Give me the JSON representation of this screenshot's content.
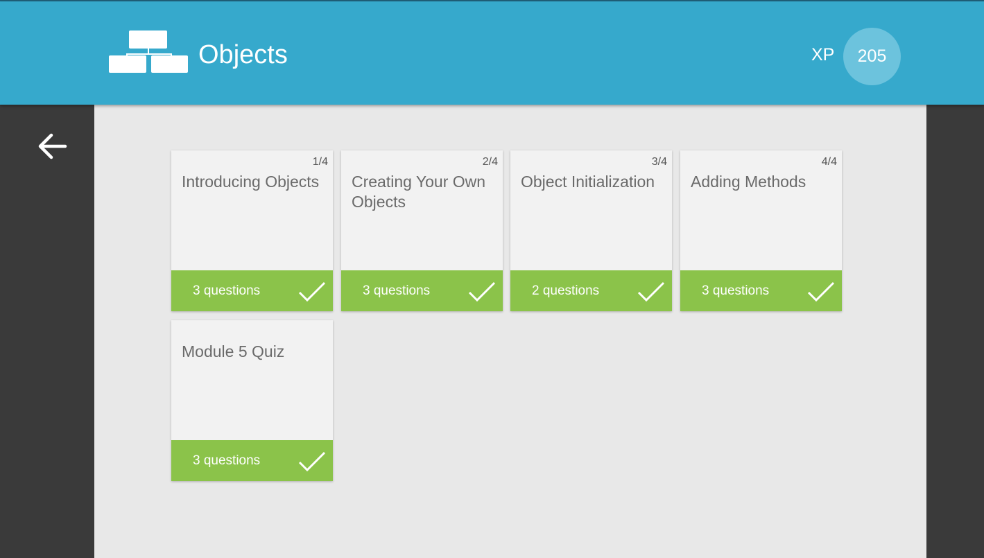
{
  "header": {
    "title": "Objects",
    "icon": "module-structure-icon",
    "xp_label": "XP",
    "xp_value": "205",
    "background_color": "#36a9cc"
  },
  "navigation": {
    "back_icon": "arrow-left-icon"
  },
  "lessons": [
    {
      "index": "1/4",
      "title": "Introducing Objects",
      "questions": "3 questions",
      "completed": true
    },
    {
      "index": "2/4",
      "title": "Creating Your Own Objects",
      "questions": "3 questions",
      "completed": true
    },
    {
      "index": "3/4",
      "title": "Object Initialization",
      "questions": "2 questions",
      "completed": true
    },
    {
      "index": "4/4",
      "title": "Adding Methods",
      "questions": "3 questions",
      "completed": true
    },
    {
      "index": "",
      "title": "Module 5 Quiz",
      "questions": "3 questions",
      "completed": true
    }
  ],
  "colors": {
    "completed_green": "#8bc34a",
    "card_background": "#f2f2f2",
    "content_background": "#e8e8e8",
    "side_background": "#3a3a3a"
  }
}
